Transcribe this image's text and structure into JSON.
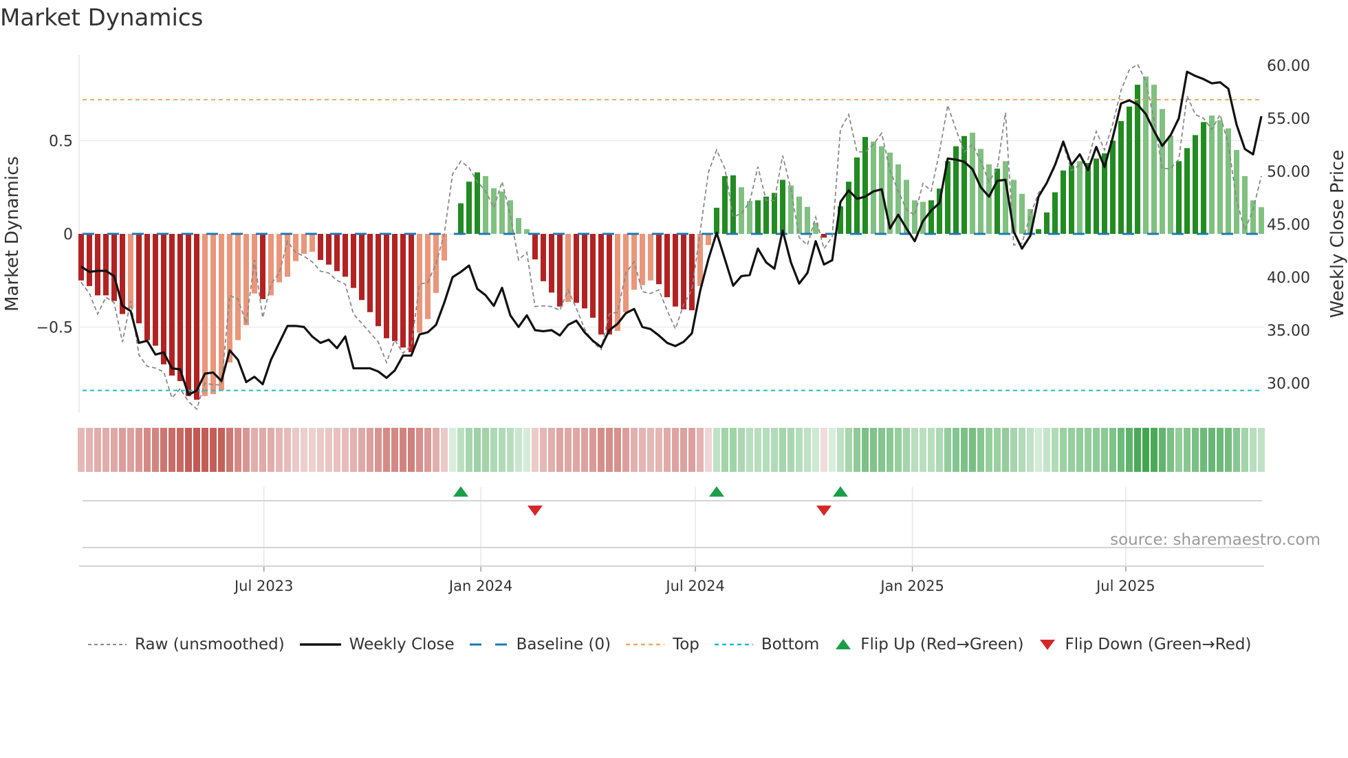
{
  "title": "Market Dynamics",
  "source": "source: sharemaestro.com",
  "legend": {
    "raw": "Raw (unsmoothed)",
    "close": "Weekly Close",
    "baseline": "Baseline (0)",
    "top": "Top",
    "bottom": "Bottom",
    "flip_up": "Flip Up (Red→Green)",
    "flip_down": "Flip Down (Green→Red)"
  },
  "colors": {
    "bar_red_strong": "#b22222",
    "bar_red_weak": "#e9967a",
    "bar_green_strong": "#228b22",
    "bar_green_weak": "#80c080",
    "baseline": "#1f77b4",
    "top": "#f0a868",
    "bottom": "#17becf",
    "raw": "#888888",
    "close": "#111111",
    "flip_up": "#1a9e4a",
    "flip_down": "#d62728"
  },
  "chart_data": {
    "type": "bar",
    "title": "Market Dynamics",
    "ylabel": "Market Dynamics",
    "ylabel_right": "Weekly Close Price",
    "ylim": [
      -0.97,
      0.97
    ],
    "ylim_right": [
      27.3,
      62.6
    ],
    "start_date": "2023-01-27",
    "interval_days": 7,
    "yticks_left": [
      {
        "v": 0.5,
        "label": "0.5"
      },
      {
        "v": 0,
        "label": "0"
      },
      {
        "v": -0.5,
        "label": "−0.5"
      }
    ],
    "yticks_right": [
      {
        "v": 60,
        "label": "60.00"
      },
      {
        "v": 55,
        "label": "55.00"
      },
      {
        "v": 50,
        "label": "50.00"
      },
      {
        "v": 45,
        "label": "45.00"
      },
      {
        "v": 40,
        "label": "40.00"
      },
      {
        "v": 35,
        "label": "35.00"
      },
      {
        "v": 30,
        "label": "30.00"
      }
    ],
    "xticks": [
      {
        "date": "2023-07-01",
        "label": "Jul 2023"
      },
      {
        "date": "2024-01-01",
        "label": "Jan 2024"
      },
      {
        "date": "2024-07-01",
        "label": "Jul 2024"
      },
      {
        "date": "2025-01-01",
        "label": "Jan 2025"
      },
      {
        "date": "2025-07-01",
        "label": "Jul 2025"
      }
    ],
    "top_level": 0.72,
    "bottom_level": -0.84,
    "baseline": 0,
    "momentum": [
      -0.25,
      -0.28,
      -0.33,
      -0.33,
      -0.36,
      -0.43,
      -0.4,
      -0.48,
      -0.57,
      -0.6,
      -0.7,
      -0.76,
      -0.79,
      -0.87,
      -0.89,
      -0.87,
      -0.86,
      -0.84,
      -0.69,
      -0.57,
      -0.49,
      -0.32,
      -0.35,
      -0.33,
      -0.26,
      -0.23,
      -0.146,
      -0.107,
      -0.096,
      -0.14,
      -0.165,
      -0.2,
      -0.23,
      -0.29,
      -0.355,
      -0.42,
      -0.495,
      -0.56,
      -0.575,
      -0.61,
      -0.635,
      -0.53,
      -0.457,
      -0.317,
      -0.143,
      0,
      0.164,
      0.28,
      0.33,
      0.31,
      0.245,
      0.227,
      0.18,
      0.085,
      0.025,
      -0.137,
      -0.254,
      -0.315,
      -0.39,
      -0.365,
      -0.37,
      -0.4,
      -0.45,
      -0.54,
      -0.54,
      -0.52,
      -0.42,
      -0.3,
      -0.275,
      -0.25,
      -0.27,
      -0.34,
      -0.39,
      -0.405,
      -0.41,
      -0.28,
      -0.06,
      0.14,
      0.31,
      0.314,
      0.25,
      0.176,
      0.18,
      0.2,
      0.22,
      0.29,
      0.26,
      0.2,
      0.145,
      0.06,
      -0.02,
      0,
      0.148,
      0.28,
      0.41,
      0.52,
      0.495,
      0.47,
      0.436,
      0.373,
      0.29,
      0.18,
      0.172,
      0.18,
      0.243,
      0.39,
      0.47,
      0.525,
      0.543,
      0.456,
      0.373,
      0.35,
      0.39,
      0.29,
      0.215,
      0.133,
      0.025,
      0.115,
      0.223,
      0.34,
      0.367,
      0.39,
      0.38,
      0.404,
      0.432,
      0.5,
      0.605,
      0.683,
      0.8,
      0.844,
      0.8,
      0.67,
      0.527,
      0.39,
      0.46,
      0.53,
      0.6,
      0.635,
      0.61,
      0.566,
      0.45,
      0.31,
      0.18,
      0.143
    ],
    "strength": "DDDDDDLDDDDDDDDLLLLLLLDLLLLLLDDDDDDDDDDDDLLLLLDDDLLLLLLDDDDLDDDDDLLLLLDDDDDLLDDDLLDDDDLLLLDLDDDDLLLLLLLDDDDDLLLDLLLLDDDDDLDDDDDDDLLLLDDDDLLLLLL",
    "raw": [
      -0.26,
      -0.32,
      -0.43,
      -0.34,
      -0.37,
      -0.58,
      -0.36,
      -0.65,
      -0.71,
      -0.72,
      -0.74,
      -0.88,
      -0.83,
      -0.9,
      -0.94,
      -0.8,
      -0.81,
      -0.81,
      -0.33,
      -0.35,
      -0.48,
      -0.14,
      -0.45,
      -0.27,
      -0.21,
      -0.04,
      -0.1,
      -0.12,
      -0.15,
      -0.2,
      -0.21,
      -0.25,
      -0.27,
      -0.43,
      -0.48,
      -0.53,
      -0.58,
      -0.69,
      -0.57,
      -0.64,
      -0.6,
      -0.27,
      -0.26,
      -0.16,
      0.0,
      0.32,
      0.39,
      0.355,
      0.28,
      0.23,
      0.14,
      0.28,
      0.1,
      -0.14,
      -0.1,
      -0.39,
      -0.386,
      -0.39,
      -0.41,
      -0.3,
      -0.4,
      -0.51,
      -0.58,
      -0.62,
      -0.43,
      -0.42,
      -0.21,
      -0.15,
      -0.31,
      -0.32,
      -0.3,
      -0.41,
      -0.51,
      -0.38,
      -0.3,
      0.01,
      0.33,
      0.45,
      0.35,
      0.09,
      0.11,
      0.17,
      0.36,
      0.18,
      0.18,
      0.42,
      0.24,
      -0.02,
      -0.06,
      0.09,
      -0.08,
      -0.015,
      0.56,
      0.64,
      0.44,
      0.44,
      0.48,
      0.54,
      0.34,
      0.23,
      0.13,
      0.1,
      0.27,
      0.23,
      0.44,
      0.69,
      0.56,
      0.44,
      0.48,
      0.39,
      0.28,
      0.35,
      0.65,
      -0.06,
      -0.05,
      0.1,
      0.22,
      0.27,
      0.36,
      0.48,
      0.34,
      0.37,
      0.4,
      0.55,
      0.45,
      0.59,
      0.77,
      0.88,
      0.91,
      0.82,
      0.61,
      0.35,
      0.35,
      0.4,
      0.74,
      0.64,
      0.62,
      0.56,
      0.64,
      0.48,
      0.18,
      0.02,
      0.13,
      0.31
    ],
    "close": [
      41.0,
      40.5,
      40.6,
      40.6,
      40.1,
      37.3,
      36.8,
      33.8,
      34.0,
      32.7,
      32.9,
      31.4,
      31.3,
      28.9,
      29.3,
      30.9,
      31.0,
      30.2,
      33.1,
      32.2,
      30.1,
      30.6,
      29.9,
      32.2,
      33.8,
      35.4,
      35.4,
      35.3,
      34.4,
      33.8,
      34.1,
      33.3,
      34.4,
      31.4,
      31.4,
      31.4,
      31.1,
      30.5,
      31.2,
      32.6,
      32.6,
      34.6,
      34.8,
      35.5,
      37.6,
      40.0,
      40.5,
      41.1,
      38.9,
      38.3,
      37.3,
      39.0,
      36.4,
      35.3,
      36.4,
      35.0,
      34.9,
      35.0,
      34.5,
      35.5,
      35.9,
      34.8,
      34.0,
      33.4,
      35.0,
      35.6,
      36.6,
      37.0,
      35.3,
      35.1,
      34.5,
      33.8,
      33.5,
      33.9,
      34.7,
      38.7,
      41.7,
      44.2,
      41.7,
      39.2,
      40.1,
      40.2,
      42.7,
      41.4,
      40.8,
      44.4,
      41.4,
      39.4,
      40.4,
      43.4,
      41.2,
      41.6,
      47.1,
      48.2,
      47.4,
      47.6,
      48.1,
      48.3,
      44.6,
      45.9,
      44.6,
      43.4,
      45.3,
      46.3,
      47.0,
      51.2,
      51.1,
      50.9,
      50.2,
      48.5,
      47.6,
      49.1,
      49.2,
      44.3,
      42.7,
      43.9,
      47.6,
      48.9,
      50.6,
      52.8,
      50.6,
      51.6,
      50.1,
      52.3,
      50.4,
      53.2,
      56.4,
      56.7,
      56.3,
      55.4,
      53.8,
      52.4,
      53.4,
      55.0,
      59.4,
      59.0,
      58.7,
      58.3,
      58.4,
      57.8,
      54.4,
      52.1,
      51.6,
      55.2
    ],
    "flip_up_dates": [
      "2023-12-15",
      "2024-07-19",
      "2024-11-01"
    ],
    "flip_down_dates": [
      "2024-02-16",
      "2024-10-18"
    ]
  }
}
